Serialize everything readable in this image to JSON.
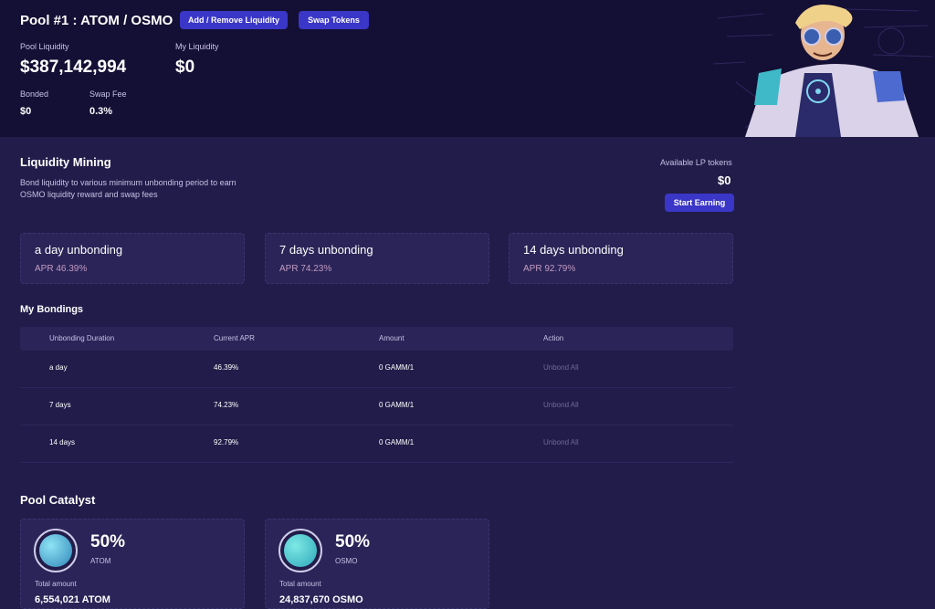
{
  "pool": {
    "title": "Pool #1 : ATOM / OSMO",
    "add_remove_label": "Add / Remove Liquidity",
    "swap_label": "Swap Tokens",
    "pool_liquidity_label": "Pool Liquidity",
    "pool_liquidity_value": "$387,142,994",
    "my_liquidity_label": "My Liquidity",
    "my_liquidity_value": "$0",
    "bonded_label": "Bonded",
    "bonded_value": "$0",
    "swap_fee_label": "Swap Fee",
    "swap_fee_value": "0.3%"
  },
  "mining": {
    "title": "Liquidity Mining",
    "description": "Bond liquidity to various minimum unbonding period to earn OSMO liquidity reward and swap fees",
    "available_label": "Available LP tokens",
    "available_value": "$0",
    "start_label": "Start Earning",
    "cards": [
      {
        "title": "a day unbonding",
        "apr": "APR 46.39%"
      },
      {
        "title": "7 days unbonding",
        "apr": "APR 74.23%"
      },
      {
        "title": "14 days unbonding",
        "apr": "APR 92.79%"
      }
    ]
  },
  "bondings": {
    "title": "My Bondings",
    "headers": [
      "Unbonding Duration",
      "Current APR",
      "Amount",
      "Action"
    ],
    "rows": [
      {
        "duration": "a day",
        "apr": "46.39%",
        "amount": "0 GAMM/1",
        "action": "Unbond All"
      },
      {
        "duration": "7 days",
        "apr": "74.23%",
        "amount": "0 GAMM/1",
        "action": "Unbond All"
      },
      {
        "duration": "14 days",
        "apr": "92.79%",
        "amount": "0 GAMM/1",
        "action": "Unbond All"
      }
    ]
  },
  "catalyst": {
    "title": "Pool Catalyst",
    "items": [
      {
        "percent": "50%",
        "token": "ATOM",
        "total_label": "Total amount",
        "total_value": "6,554,021 ATOM",
        "color": "#3fa3c9",
        "icon": "atom-coin-icon"
      },
      {
        "percent": "50%",
        "token": "OSMO",
        "total_label": "Total amount",
        "total_value": "24,837,670 OSMO",
        "color": "#3fb9c8",
        "icon": "osmo-coin-icon"
      }
    ]
  },
  "colors": {
    "header_bg": "#140f34",
    "body_bg": "#221c4a",
    "card_bg": "#2a2458",
    "accent": "#3a36c7",
    "apr_text": "#c49bc0"
  }
}
